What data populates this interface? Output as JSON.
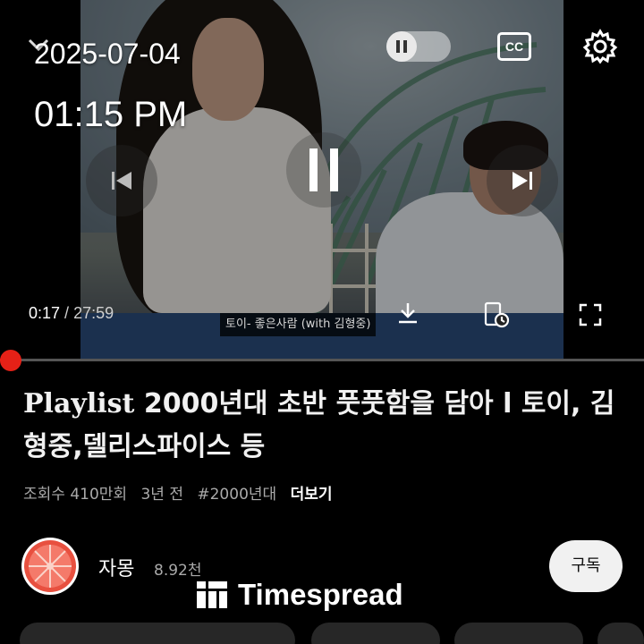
{
  "overlay": {
    "date": "2025-07-04",
    "time": "01:15 PM"
  },
  "player": {
    "current_time": "0:17",
    "separator": " / ",
    "duration": "27:59",
    "caption": "토이- 좋은사람 (with 김형중)",
    "cc_label": "CC",
    "autoplay_on": false,
    "progress_fraction": 0.01,
    "accent_color": "#e62117"
  },
  "video": {
    "title_prefix": "Playlist",
    "title_rest": " 2000년대 초반 풋풋함을 담아 l 토이, 김형중,델리스파이스 등",
    "views": "조회수 410만회",
    "age": "3년 전",
    "hashtag": "#2000년대",
    "more": "더보기"
  },
  "channel": {
    "name": "자몽",
    "subscribers": "8.92천",
    "subscribe_label": "구독"
  },
  "watermark": {
    "text": "Timespread"
  },
  "icons": [
    "chevron-down-icon",
    "pause-icon",
    "cc-icon",
    "gear-icon",
    "previous-icon",
    "next-icon",
    "download-icon",
    "saved-clock-icon",
    "fullscreen-icon"
  ]
}
